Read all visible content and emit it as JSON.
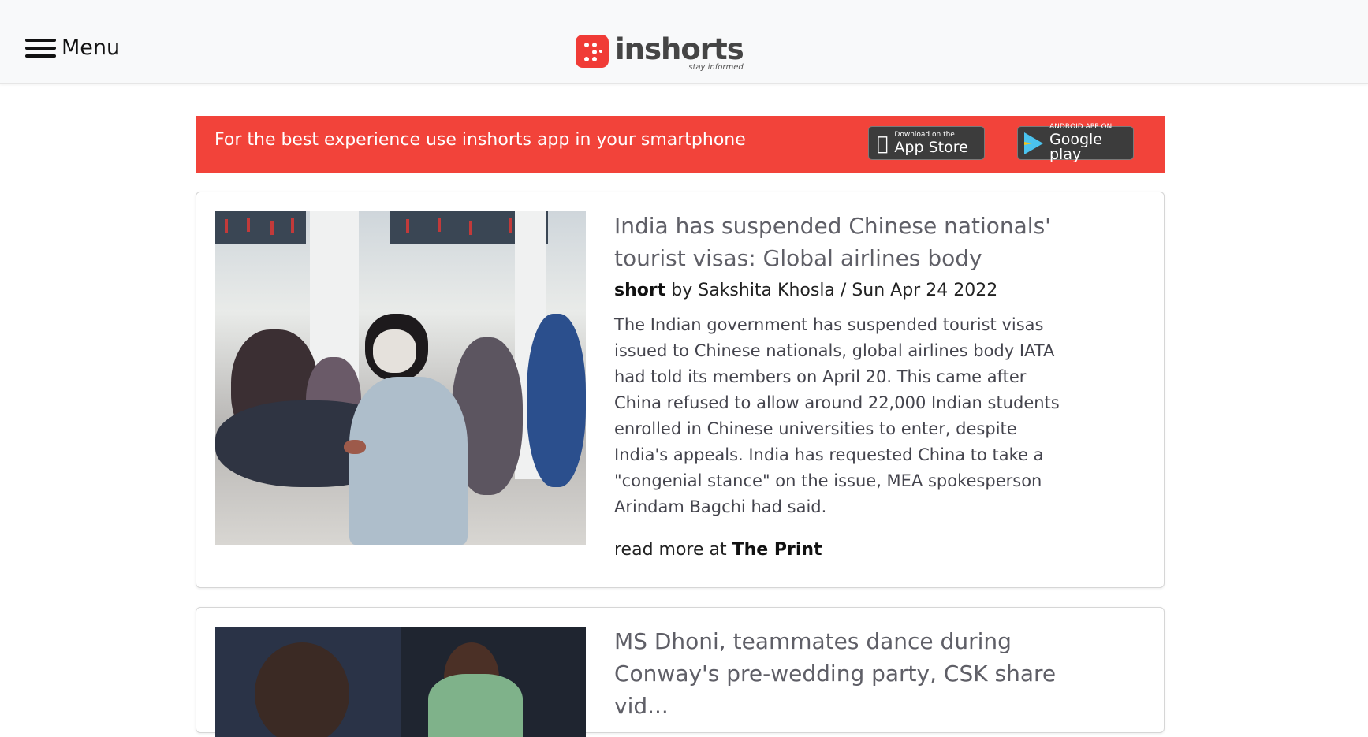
{
  "header": {
    "menu_label": "Menu",
    "logo_name": "inshorts",
    "logo_tagline": "stay informed",
    "logo_color": "#f03b36"
  },
  "banner": {
    "text": "For the best experience use inshorts app in your smartphone",
    "bg_color": "#f2433a",
    "appstore_small": "Download on the",
    "appstore_big": "App Store",
    "googleplay_small": "ANDROID APP ON",
    "googleplay_big": "Google play"
  },
  "articles": [
    {
      "title": "India has suspended Chinese nationals' tourist visas: Global airlines body",
      "type": "short",
      "by": "by Sakshita Khosla / Sun Apr 24 2022",
      "content": "The Indian government has suspended tourist visas issued to Chinese nationals, global airlines body IATA had told its members on April 20. This came after China refused to allow around 22,000 Indian students enrolled in Chinese universities to enter, despite India's appeals. India has requested China to take a \"congenial stance\" on the issue, MEA spokesperson Arindam Bagchi had said.",
      "readmore_prefix": "read more at",
      "source": "The Print"
    },
    {
      "title": "MS Dhoni, teammates dance during Conway's pre-wedding party, CSK share vid..."
    }
  ]
}
